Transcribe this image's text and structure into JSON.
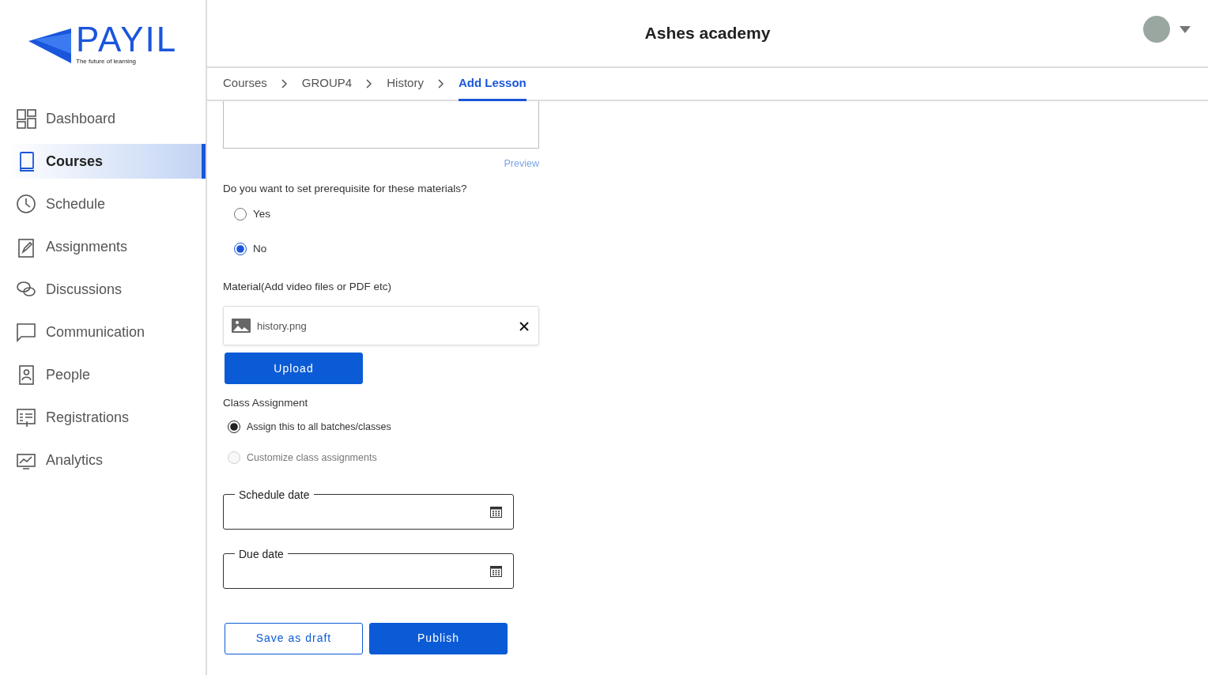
{
  "logo": {
    "name": "PAYIL",
    "tagline": "The future of learning"
  },
  "sidebar": {
    "items": [
      {
        "label": "Dashboard",
        "selected": false
      },
      {
        "label": "Courses",
        "selected": true
      },
      {
        "label": "Schedule",
        "selected": false
      },
      {
        "label": "Assignments",
        "selected": false
      },
      {
        "label": "Discussions",
        "selected": false
      },
      {
        "label": "Communication",
        "selected": false
      },
      {
        "label": "People",
        "selected": false
      },
      {
        "label": "Registrations",
        "selected": false
      },
      {
        "label": "Analytics",
        "selected": false
      }
    ]
  },
  "header": {
    "title": "Ashes academy"
  },
  "breadcrumbs": [
    {
      "label": "Courses",
      "selected": false
    },
    {
      "label": "GROUP4",
      "selected": false
    },
    {
      "label": "History",
      "selected": false
    },
    {
      "label": "Add Lesson",
      "selected": true
    }
  ],
  "form": {
    "preview_link": "Preview",
    "prerequisite": {
      "question": "Do you want to set prerequisite for these materials?",
      "options": [
        {
          "label": "Yes",
          "selected": false
        },
        {
          "label": "No",
          "selected": true
        }
      ]
    },
    "material": {
      "label": "Material(Add video files or PDF etc)",
      "file_name": "history.png",
      "upload_button": "Upload"
    },
    "class_assignment": {
      "label": "Class Assignment",
      "options": [
        {
          "label": "Assign this to all batches/classes",
          "selected": true,
          "disabled": false
        },
        {
          "label": "Customize class assignments",
          "selected": false,
          "disabled": true
        }
      ]
    },
    "schedule_date": {
      "label": "Schedule date"
    },
    "due_date": {
      "label": "Due date"
    },
    "buttons": [
      {
        "label": "Save as draft",
        "kind": "outline"
      },
      {
        "label": "Publish",
        "kind": "primary"
      }
    ]
  }
}
